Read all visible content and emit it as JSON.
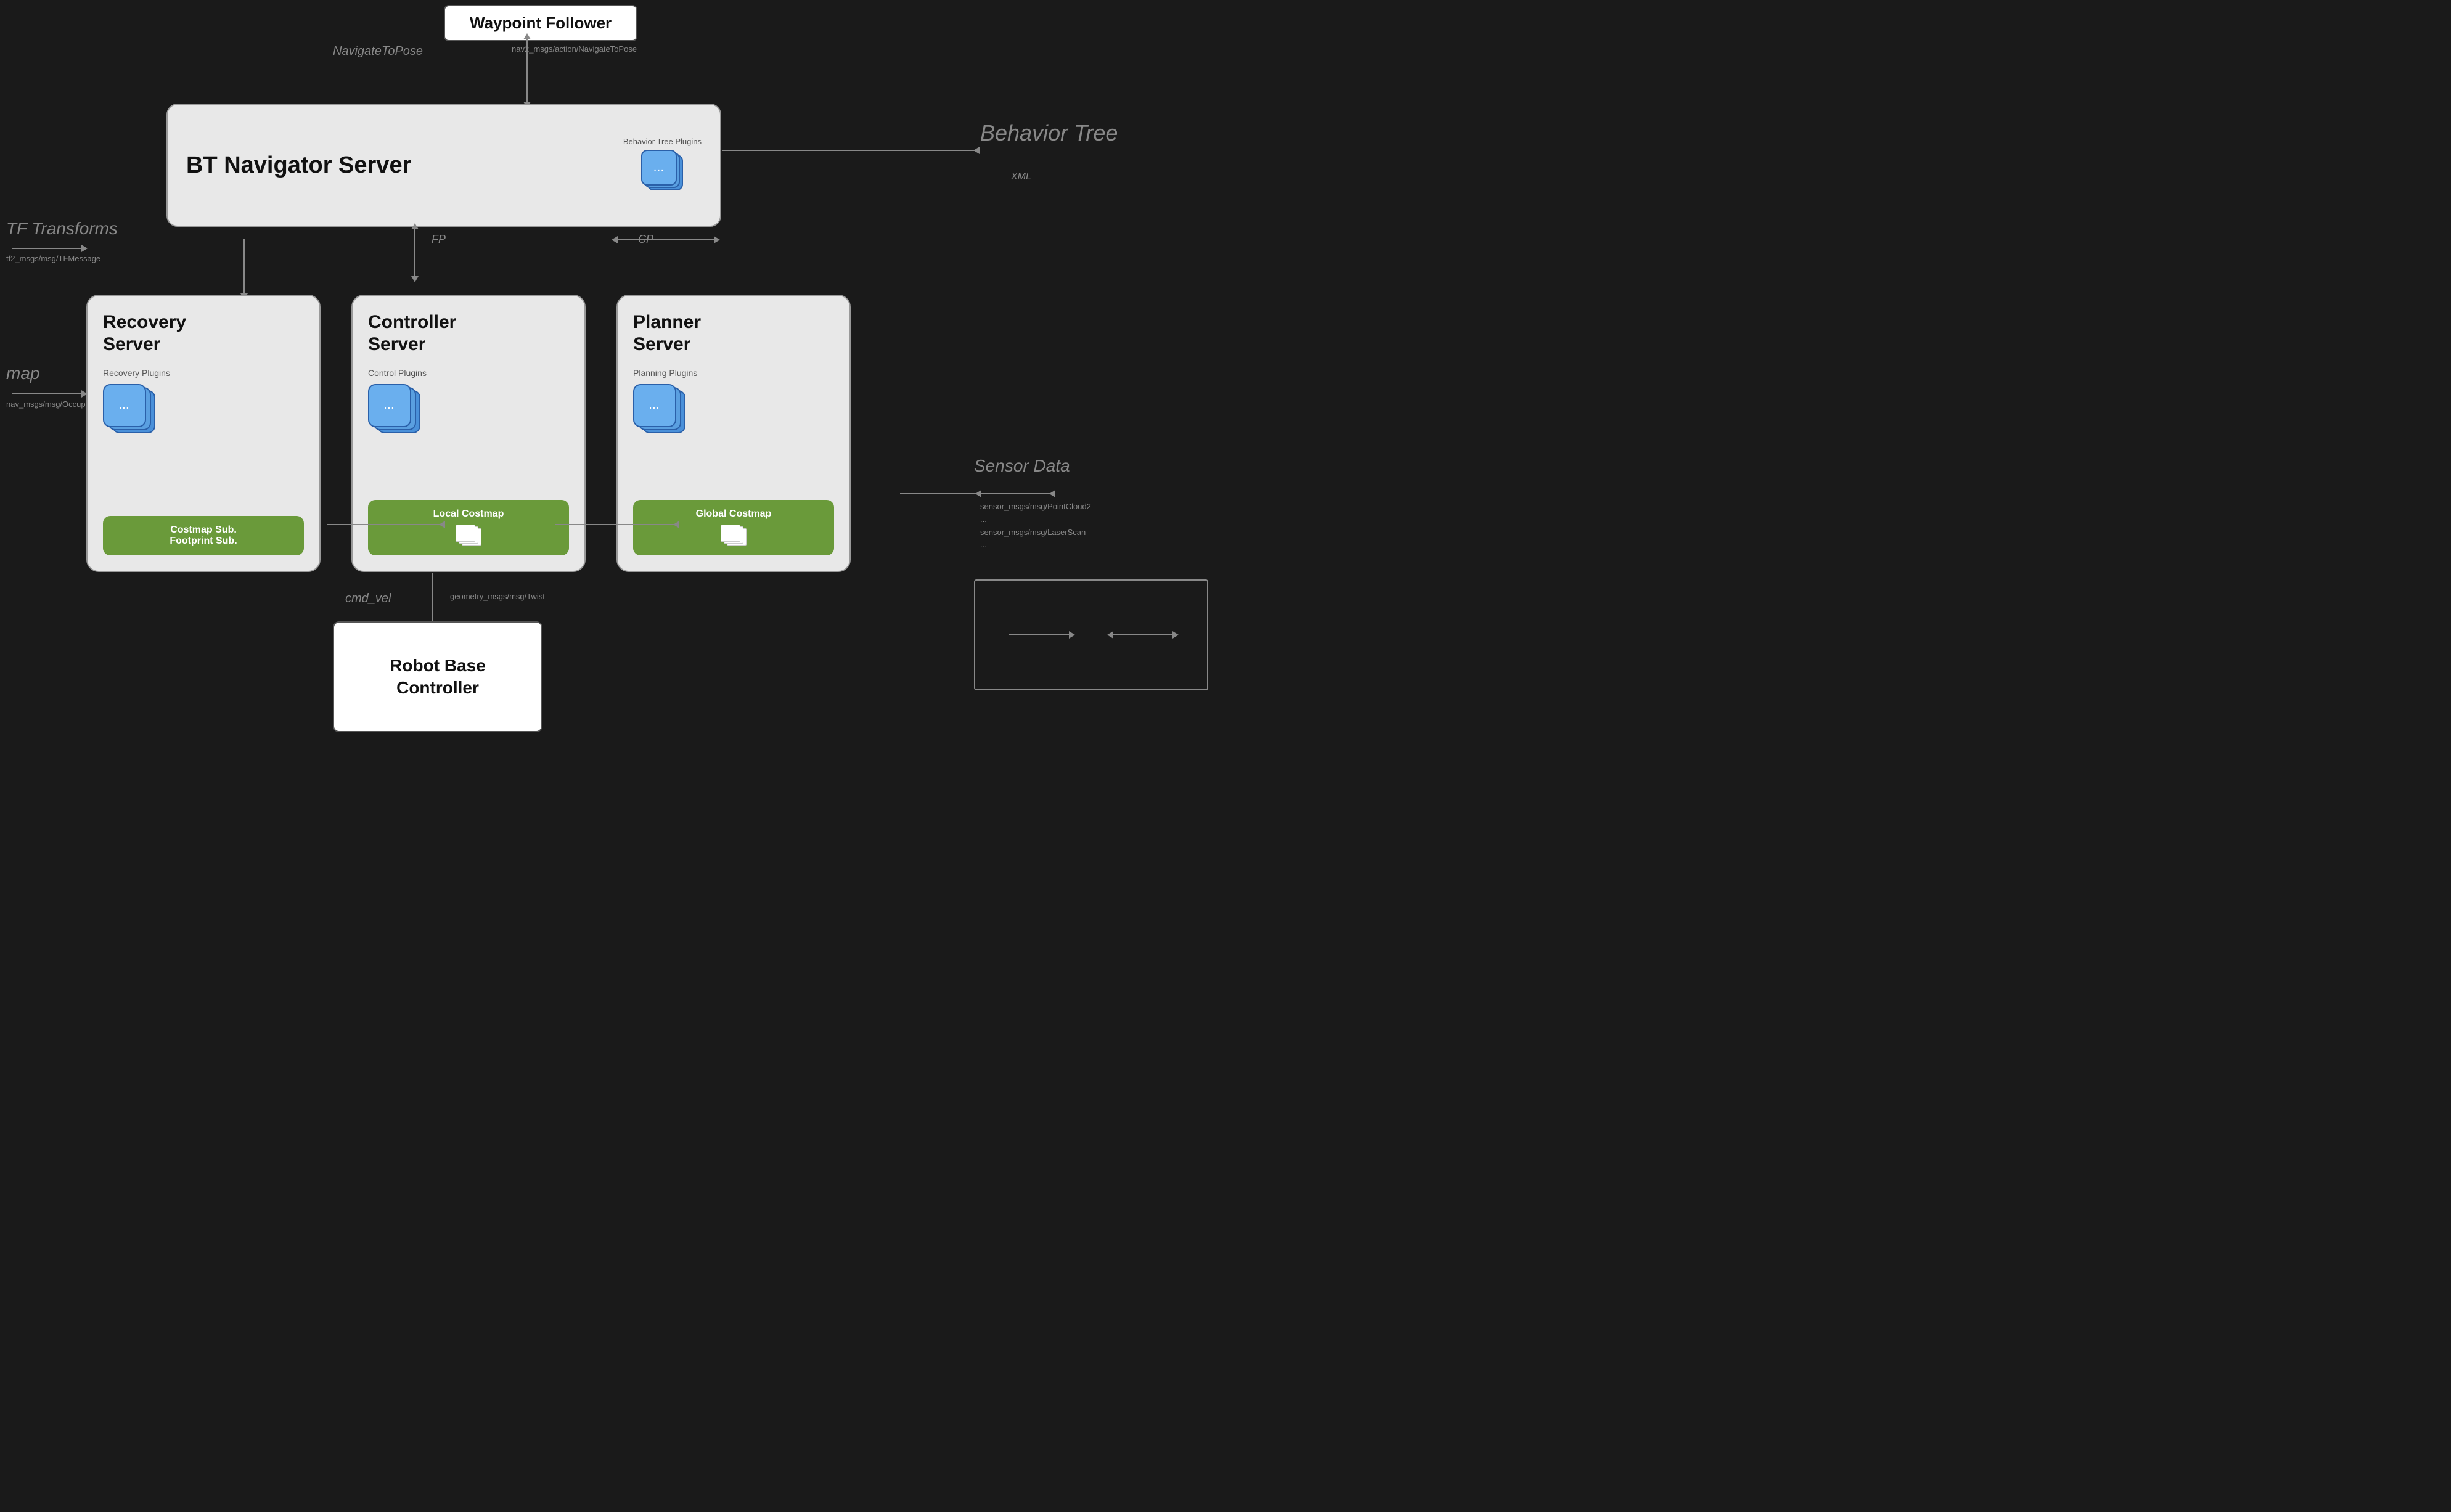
{
  "waypoint": {
    "title": "Waypoint Follower"
  },
  "navigate": {
    "label": "NavigateToPose",
    "msg": "nav2_msgs/action/NavigateToPose"
  },
  "bt_navigator": {
    "title": "BT Navigator Server",
    "plugins_label": "Behavior Tree Plugins",
    "dots": "..."
  },
  "behavior_tree": {
    "label": "Behavior Tree",
    "xml": "XML"
  },
  "tf": {
    "label": "TF Transforms",
    "msg": "tf2_msgs/msg/TFMessage"
  },
  "map": {
    "label": "map",
    "msg": "nav_msgs/msg/OccupancyGrid"
  },
  "fp_label": "FP",
  "cp_label": "CP",
  "recovery_server": {
    "title": "Recovery\nServer",
    "plugins_label": "Recovery Plugins",
    "dots": "...",
    "costmap_label": "Costmap Sub.\nFootprint Sub."
  },
  "controller_server": {
    "title": "Controller\nServer",
    "plugins_label": "Control Plugins",
    "dots": "...",
    "costmap_label": "Local Costmap"
  },
  "planner_server": {
    "title": "Planner\nServer",
    "plugins_label": "Planning Plugins",
    "dots": "...",
    "costmap_label": "Global Costmap"
  },
  "cmd_vel": {
    "label": "cmd_vel",
    "msg": "geometry_msgs/msg/Twist"
  },
  "robot_base": {
    "title": "Robot Base\nController"
  },
  "sensor": {
    "label": "Sensor Data",
    "msgs": "sensor_msgs/msg/PointCloud2\n...\nsensor_msgs/msg/LaserScan\n..."
  },
  "legend": {
    "arrow1": "→",
    "arrow2": "←→"
  }
}
